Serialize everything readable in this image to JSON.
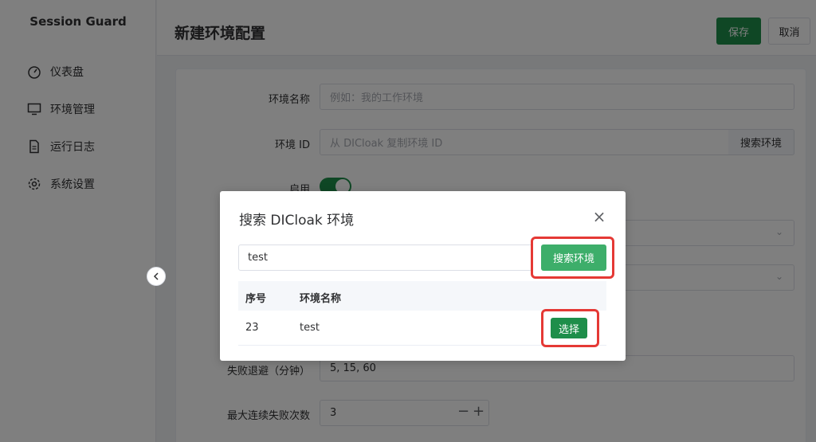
{
  "app": {
    "title": "Session Guard"
  },
  "sidebar": {
    "items": [
      {
        "label": "仪表盘",
        "icon": "dashboard-icon"
      },
      {
        "label": "环境管理",
        "icon": "monitor-icon"
      },
      {
        "label": "运行日志",
        "icon": "document-icon"
      },
      {
        "label": "系统设置",
        "icon": "gear-icon"
      }
    ]
  },
  "header": {
    "title": "新建环境配置",
    "save_label": "保存",
    "cancel_label": "取消"
  },
  "form": {
    "name_label": "环境名称",
    "name_placeholder": "例如：我的工作环境",
    "id_label": "环境 ID",
    "id_placeholder": "从 DICloak 复制环境 ID",
    "search_button": "搜索环境",
    "enable_label": "启用",
    "backoff_label": "失败退避（分钟）",
    "backoff_value": "5, 15, 60",
    "max_fail_label": "最大连续失败次数",
    "max_fail_value": "3"
  },
  "dialog": {
    "title": "搜索 DICloak 环境",
    "search_value": "test",
    "search_button": "搜索环境",
    "columns": [
      "序号",
      "环境名称"
    ],
    "rows": [
      {
        "index": "23",
        "name": "test",
        "action": "选择"
      }
    ]
  },
  "colors": {
    "primary": "#1e8e4a",
    "highlight": "#e53935"
  }
}
